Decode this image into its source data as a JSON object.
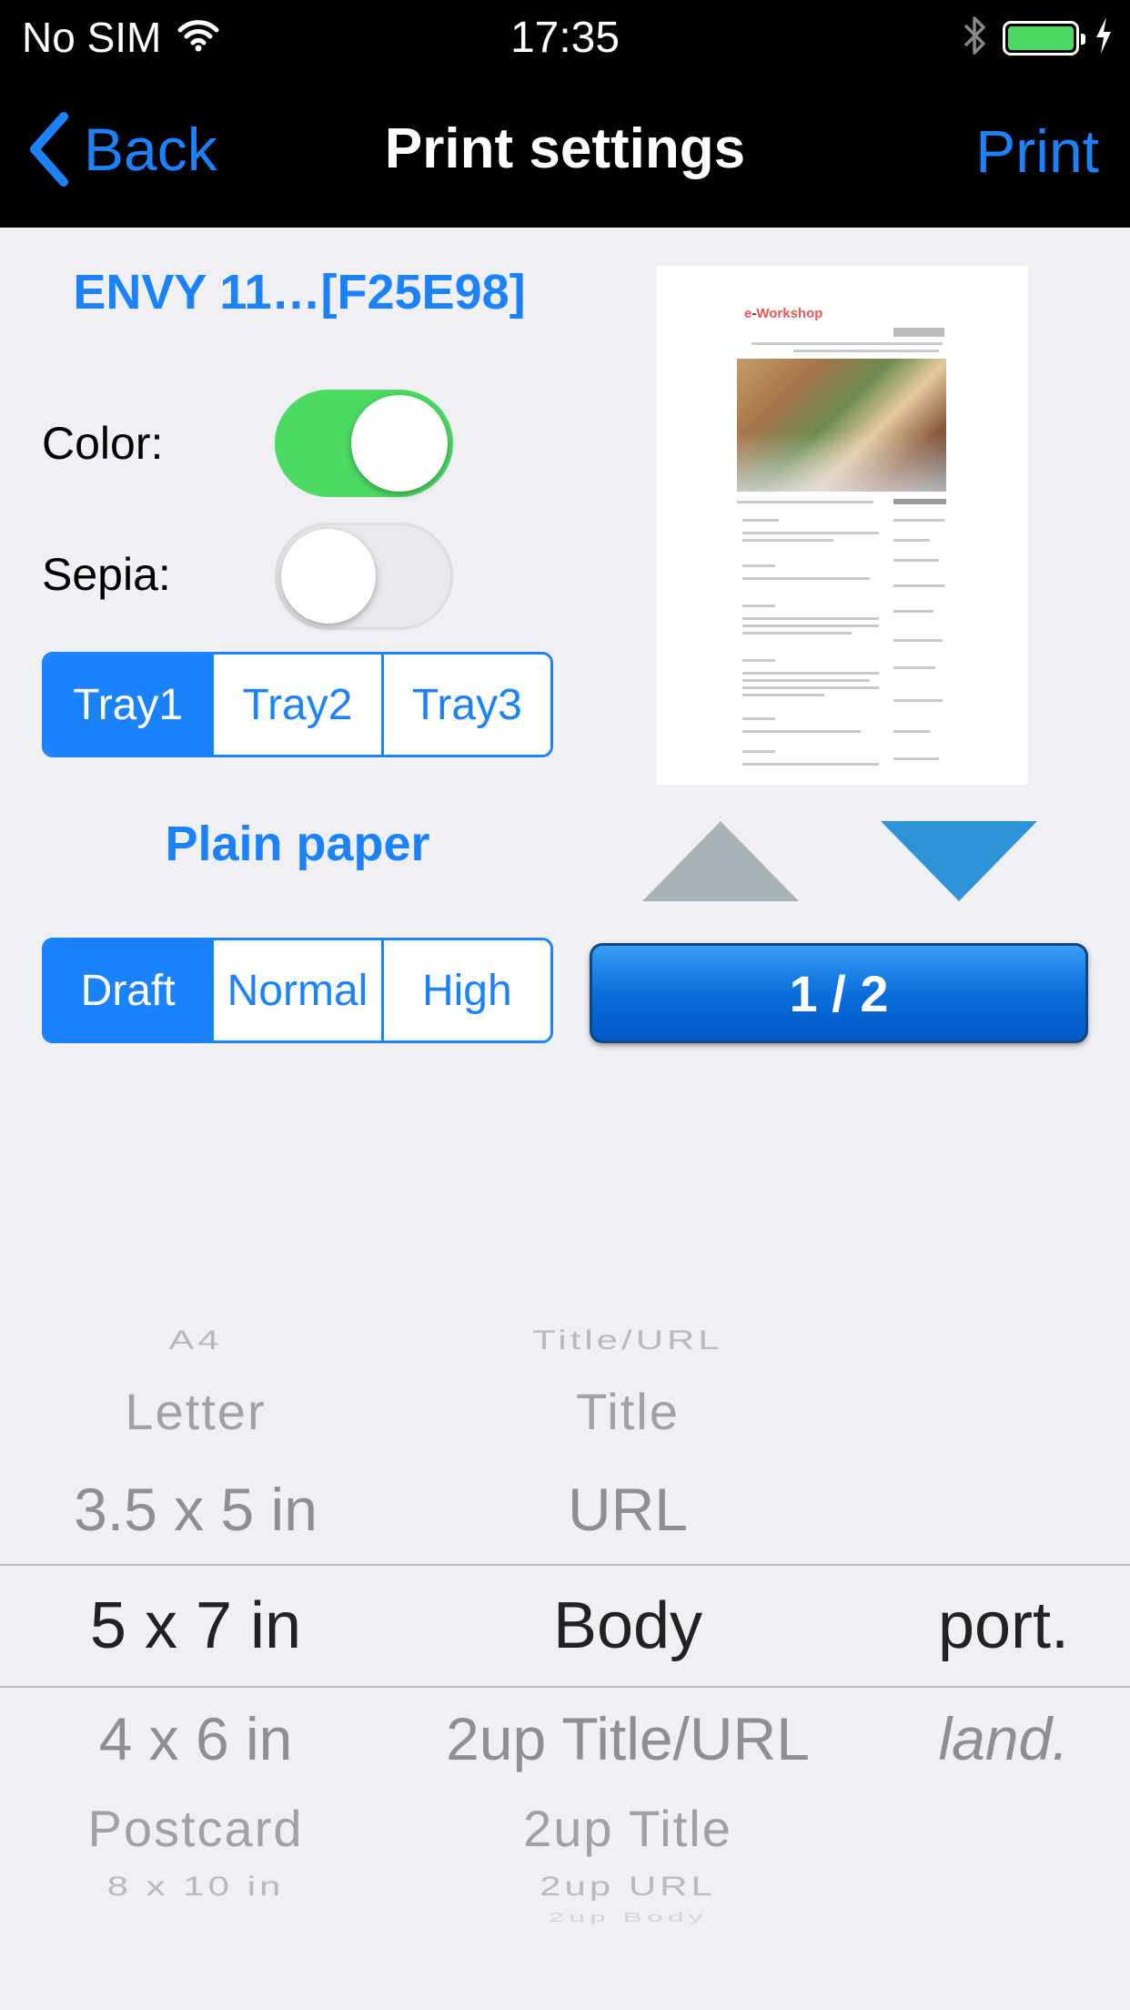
{
  "status_bar": {
    "carrier": "No SIM",
    "time": "17:35",
    "battery_level": 1.0,
    "icons": [
      "wifi-icon",
      "bluetooth-icon",
      "battery-icon",
      "charging-bolt-icon"
    ]
  },
  "nav": {
    "back_label": "Back",
    "title": "Print settings",
    "print_label": "Print"
  },
  "printer": {
    "name": "ENVY 11…[F25E98]"
  },
  "color": {
    "label": "Color:",
    "on": true
  },
  "sepia": {
    "label": "Sepia:",
    "on": false
  },
  "trays": {
    "options": [
      "Tray1",
      "Tray2",
      "Tray3"
    ],
    "selected": "Tray1"
  },
  "paper_type": "Plain paper",
  "quality": {
    "options": [
      "Draft",
      "Normal",
      "High"
    ],
    "selected": "Draft"
  },
  "preview": {
    "logo_text": "Workshop",
    "page_indicator": "1 / 2"
  },
  "picker": {
    "paper_size": {
      "items": [
        "A4",
        "Letter",
        "3.5 x 5 in",
        "5 x 7 in",
        "4 x 6 in",
        "Postcard",
        "8 x 10 in"
      ],
      "selected": "5 x 7 in"
    },
    "content": {
      "items": [
        "Title/URL",
        "Title",
        "URL",
        "Body",
        "2up Title/URL",
        "2up Title",
        "2up URL",
        "2up Body"
      ],
      "selected": "Body"
    },
    "orientation": {
      "items": [
        "port.",
        "land."
      ],
      "selected": "port."
    }
  },
  "colors": {
    "accent": "#1a82fb",
    "switch_on": "#4cd964",
    "background": "#efeff4"
  }
}
